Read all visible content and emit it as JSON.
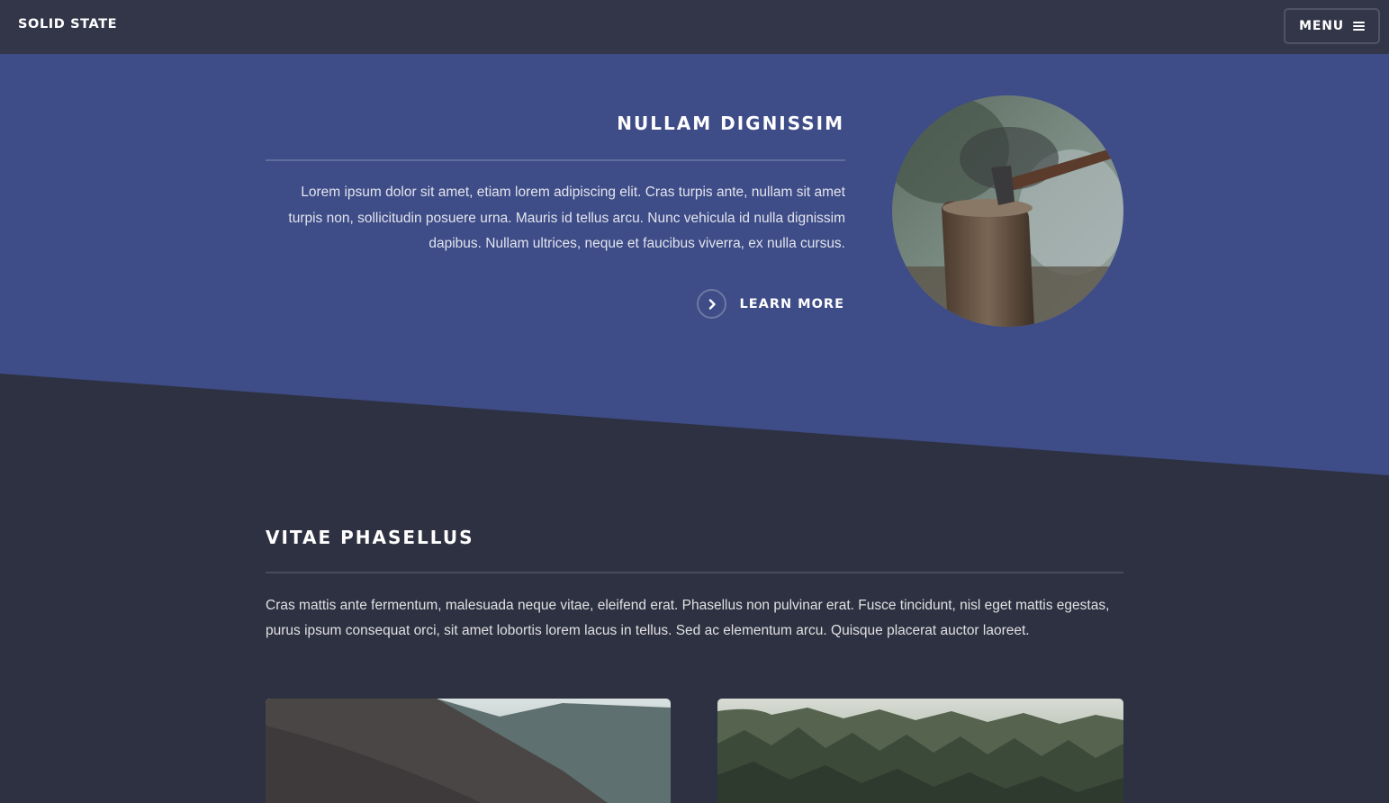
{
  "header": {
    "brand": "SOLID STATE",
    "menu_label": "MENU"
  },
  "spotlight": {
    "title": "NULLAM DIGNISSIM",
    "text": "Lorem ipsum dolor sit amet, etiam lorem adipiscing elit. Cras turpis ante, nullam sit amet turpis non, sollicitudin posuere urna. Mauris id tellus arcu. Nunc vehicula id nulla dignissim dapibus. Nullam ultrices, neque et faucibus viverra, ex nulla cursus.",
    "link_label": "LEARN MORE"
  },
  "section": {
    "title": "VITAE PHASELLUS",
    "text": "Cras mattis ante fermentum, malesuada neque vitae, eleifend erat. Phasellus non pulvinar erat. Fusce tincidunt, nisl eget mattis egestas, purus ipsum consequat orci, sit amet lobortis lorem lacus in tellus. Sed ac elementum arcu. Quisque placerat auctor laoreet."
  },
  "colors": {
    "page_bg": "#2e3141",
    "header_bg": "#333649",
    "spotlight_bg": "#3e4c87"
  },
  "icons": {
    "menu": "hamburger-icon",
    "learn_more": "chevron-right-icon"
  }
}
